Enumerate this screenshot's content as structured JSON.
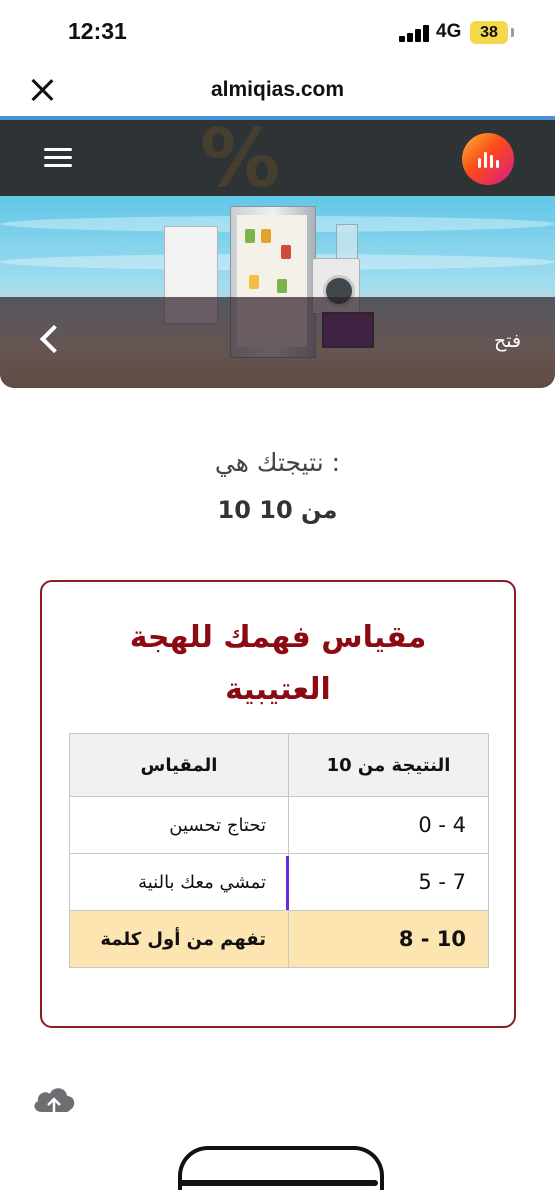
{
  "status_bar": {
    "time": "12:31",
    "network": "4G",
    "battery": "38"
  },
  "browser": {
    "url": "almiqias.com"
  },
  "banner": {
    "open_label": "فتح"
  },
  "result": {
    "label": "نتيجتك هي :",
    "score": "10 من 10"
  },
  "scale": {
    "title": "مقياس فهمك للهجة العتيبية",
    "headers": {
      "score": "النتيجة من 10",
      "scale": "المقياس"
    },
    "rows": [
      {
        "range": "0 - 4",
        "level": "تحتاج تحسين"
      },
      {
        "range": "5 - 7",
        "level": "تمشي معك بالنية"
      },
      {
        "range": "8 - 10",
        "level": "تفهم من أول كلمة"
      }
    ]
  },
  "colors": {
    "accent": "#8b0b12",
    "highlight_row": "#fde5b2",
    "url_bar_line": "#4a90d9",
    "marker": "#6b2bd9"
  },
  "icons": {
    "close": "close-icon",
    "menu": "menu-icon",
    "logo": "site-logo",
    "back": "chevron-left-icon",
    "upload": "cloud-upload-icon"
  }
}
